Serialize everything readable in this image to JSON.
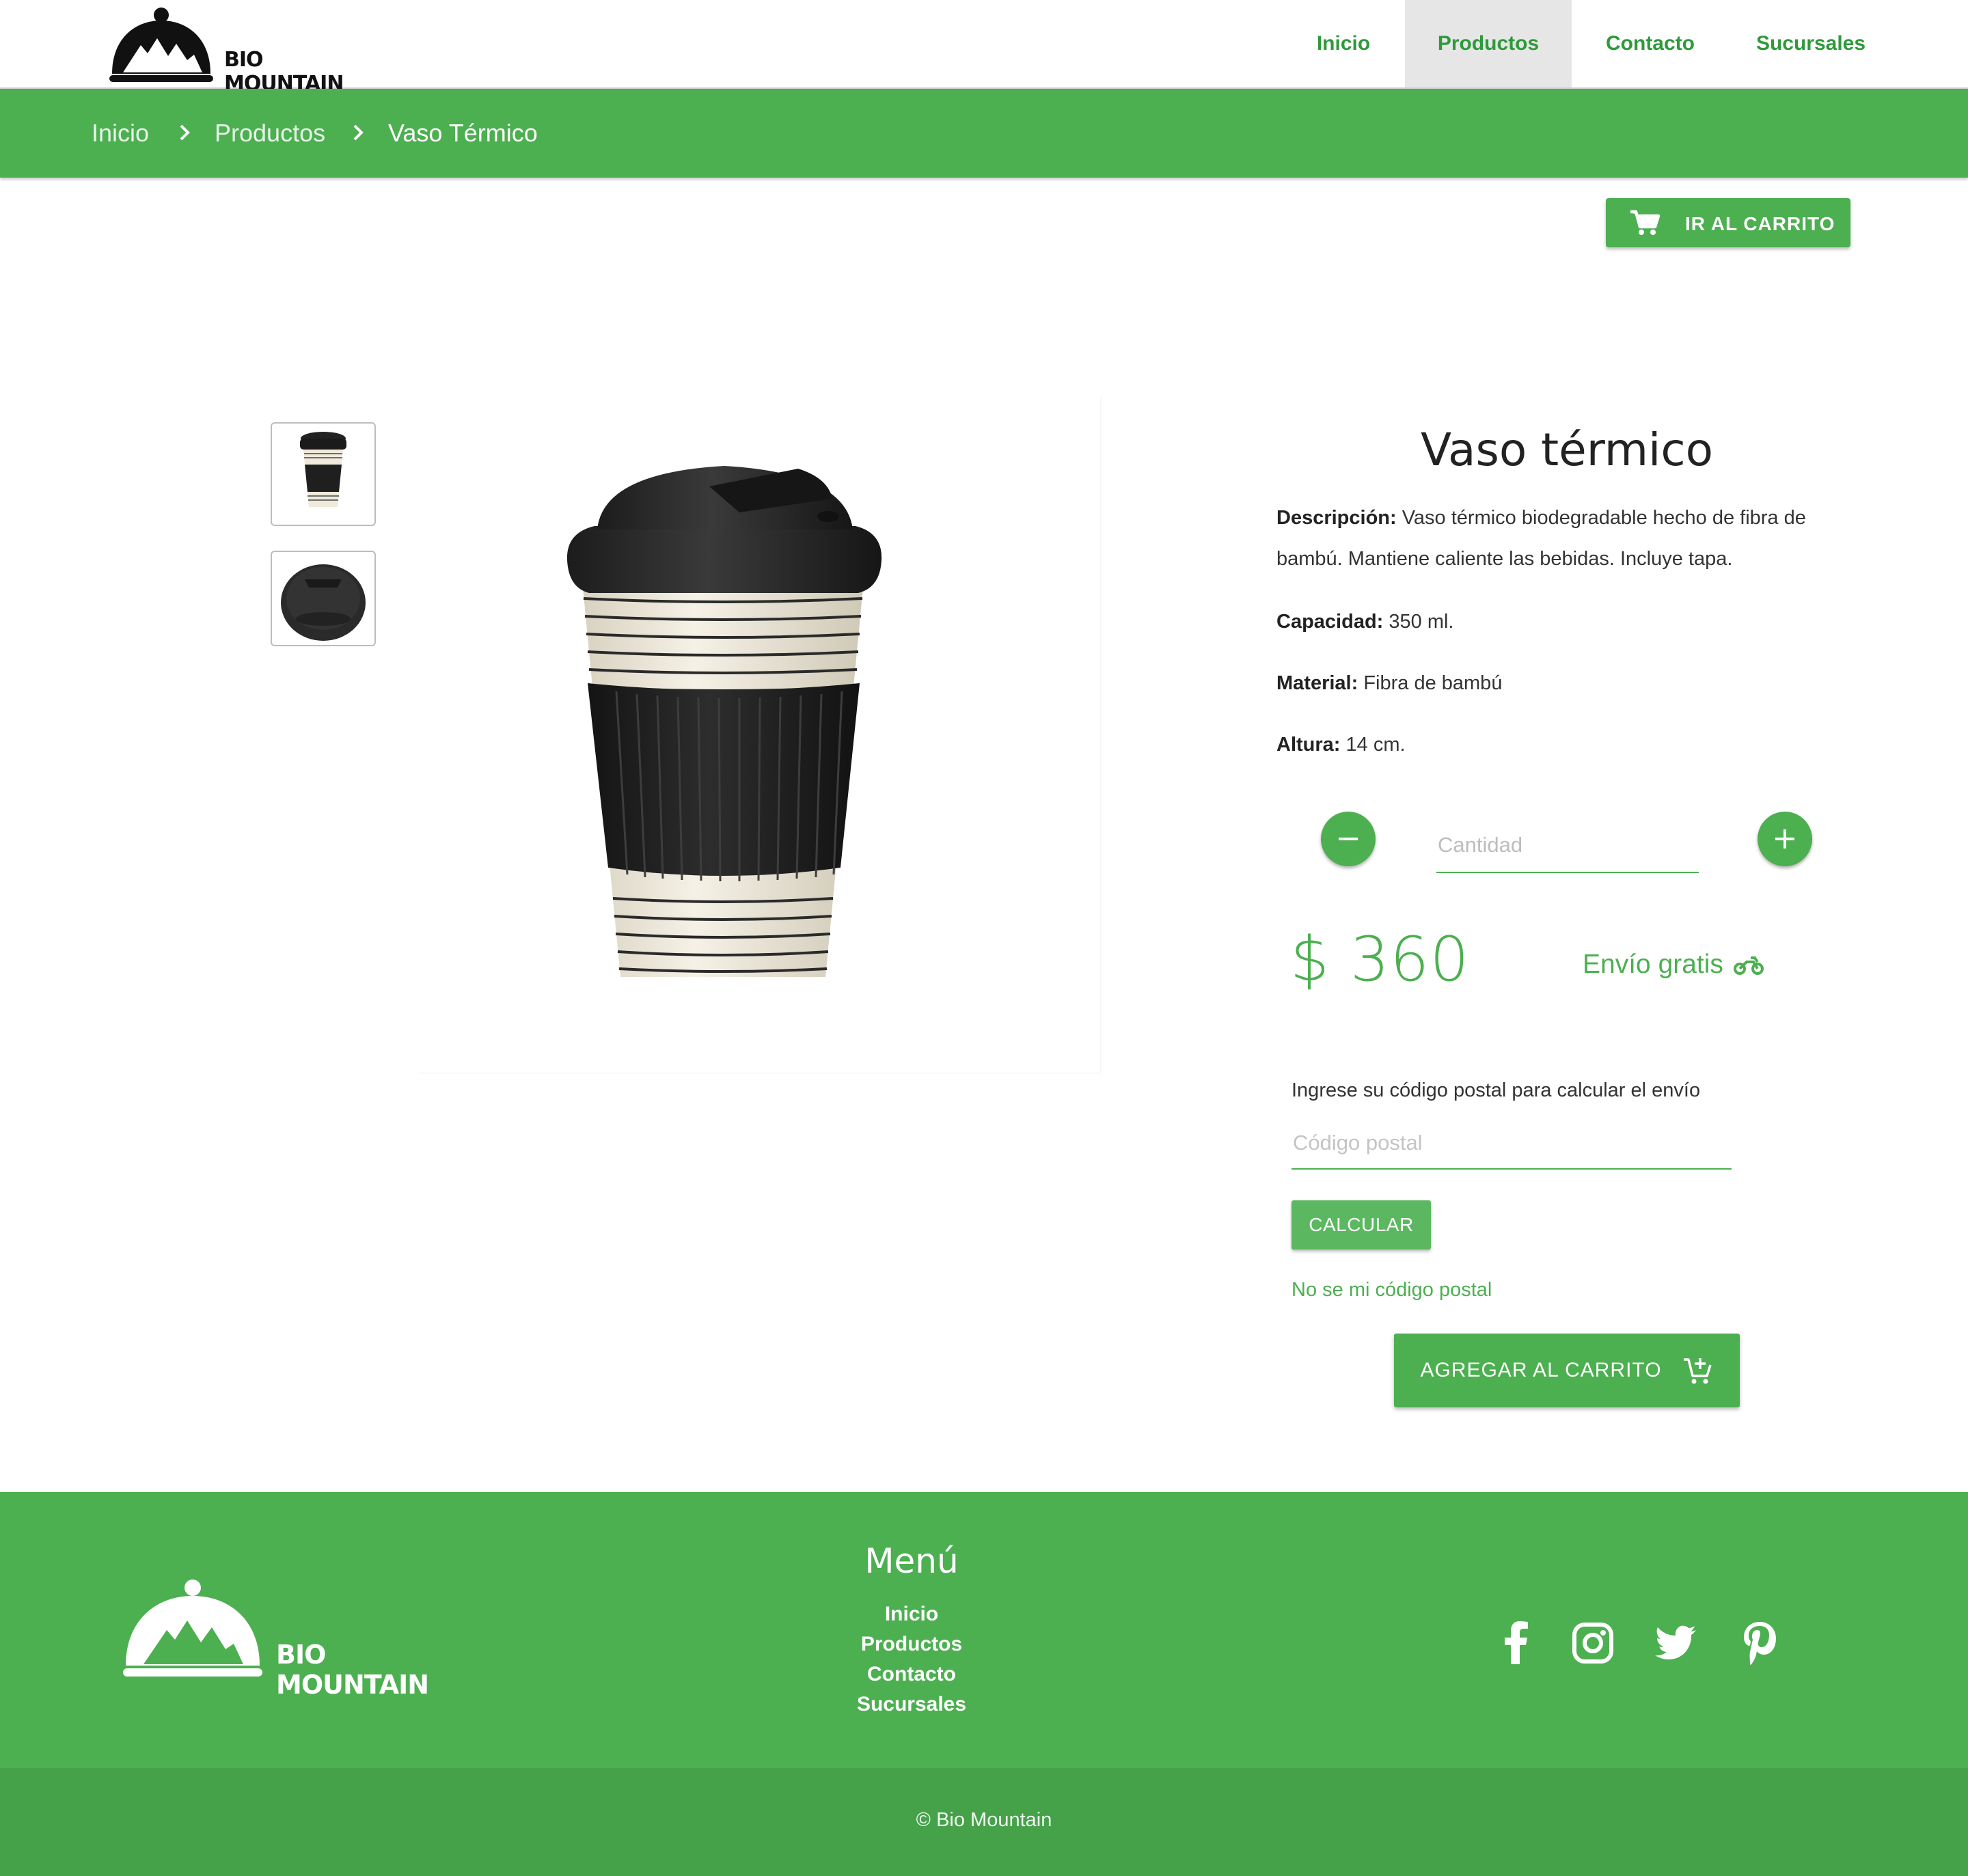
{
  "header": {
    "brand": "BIO MOUNTAIN",
    "nav": [
      {
        "label": "Inicio"
      },
      {
        "label": "Productos",
        "active": true
      },
      {
        "label": "Contacto"
      },
      {
        "label": "Sucursales"
      }
    ]
  },
  "breadcrumb": {
    "items": [
      "Inicio",
      "Productos",
      "Vaso Térmico"
    ]
  },
  "cart_button": {
    "label": "IR AL CARRITO"
  },
  "product": {
    "title": "Vaso térmico",
    "description_label": "Descripción:",
    "description": "Vaso térmico biodegradable hecho de fibra de bambú. Mantiene caliente las bebidas. Incluye tapa.",
    "capacity_label": "Capacidad:",
    "capacity": "350 ml.",
    "material_label": "Material:",
    "material": "Fibra de bambú",
    "height_label": "Altura:",
    "height": "14 cm.",
    "quantity_placeholder": "Cantidad",
    "price": "$ 360",
    "shipping": "Envío gratis",
    "zip_label": "Ingrese su código postal para calcular el envío",
    "zip_placeholder": "Código postal",
    "calc_button": "CALCULAR",
    "no_zip_link": "No se mi código postal",
    "add_to_cart": "AGREGAR AL CARRITO"
  },
  "footer": {
    "brand": "BIO MOUNTAIN",
    "menu_title": "Menú",
    "menu": [
      "Inicio",
      "Productos",
      "Contacto",
      "Sucursales"
    ],
    "social": [
      "facebook-icon",
      "instagram-icon",
      "twitter-icon",
      "pinterest-icon"
    ],
    "copyright": "© Bio Mountain"
  },
  "colors": {
    "accent": "#4caf50",
    "accent_dark": "#2e9a3a",
    "footer_bottom": "#45a249"
  }
}
